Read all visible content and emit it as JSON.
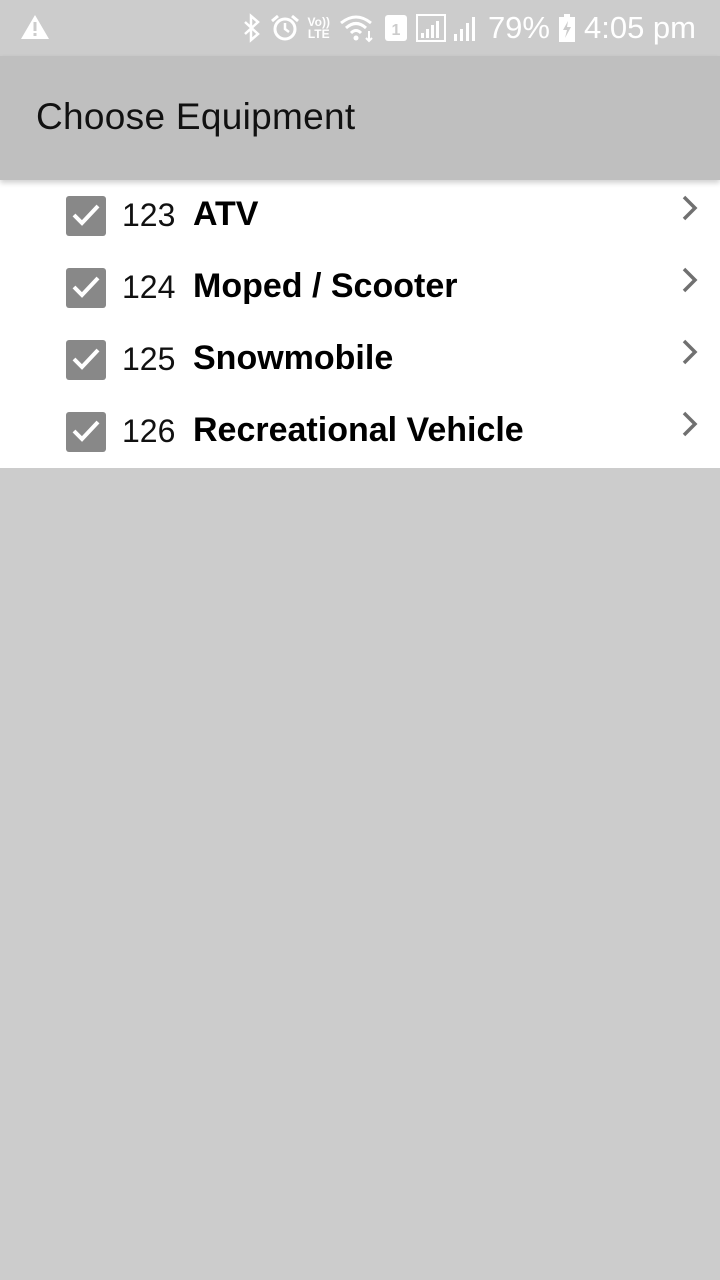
{
  "status_bar": {
    "battery": "79%",
    "time": "4:05 pm",
    "volte_top": "Vo))",
    "volte_bottom": "LTE",
    "sim_slot": "1",
    "icons": [
      "warning-icon",
      "bluetooth-icon",
      "alarm-icon",
      "volte-icon",
      "wifi-icon",
      "sim-icon",
      "signal-icon",
      "battery-charging-icon"
    ]
  },
  "app_bar": {
    "title": "Choose Equipment"
  },
  "equipment_list": {
    "items": [
      {
        "number": "123",
        "name": "ATV",
        "checked": true
      },
      {
        "number": "124",
        "name": "Moped / Scooter",
        "checked": true
      },
      {
        "number": "125",
        "name": "Snowmobile",
        "checked": true
      },
      {
        "number": "126",
        "name": "Recreational Vehicle",
        "checked": true
      }
    ]
  },
  "colors": {
    "background": "#cccccc",
    "app_bar": "#bfbfbf",
    "checkbox": "#888888",
    "chevron": "#707070"
  }
}
